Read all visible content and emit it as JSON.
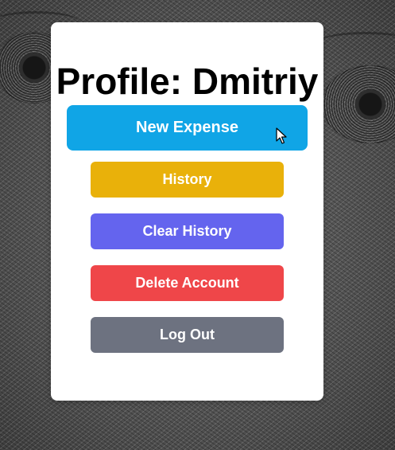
{
  "profile": {
    "title": "Profile: Dmitriy"
  },
  "actions": {
    "new_expense": {
      "label": "New Expense",
      "color": "#10A5E6"
    },
    "history": {
      "label": "History",
      "color": "#E9B10A"
    },
    "clear_history": {
      "label": "Clear History",
      "color": "#6464EE"
    },
    "delete_account": {
      "label": "Delete Account",
      "color": "#EF4649"
    },
    "log_out": {
      "label": "Log Out",
      "color": "#6D7280"
    }
  },
  "theme": {
    "card_background": "#FFFFFF",
    "title_color": "#000000",
    "button_text_color": "#FFFFFF"
  },
  "cursor": {
    "icon": "mouse-pointer-icon"
  }
}
